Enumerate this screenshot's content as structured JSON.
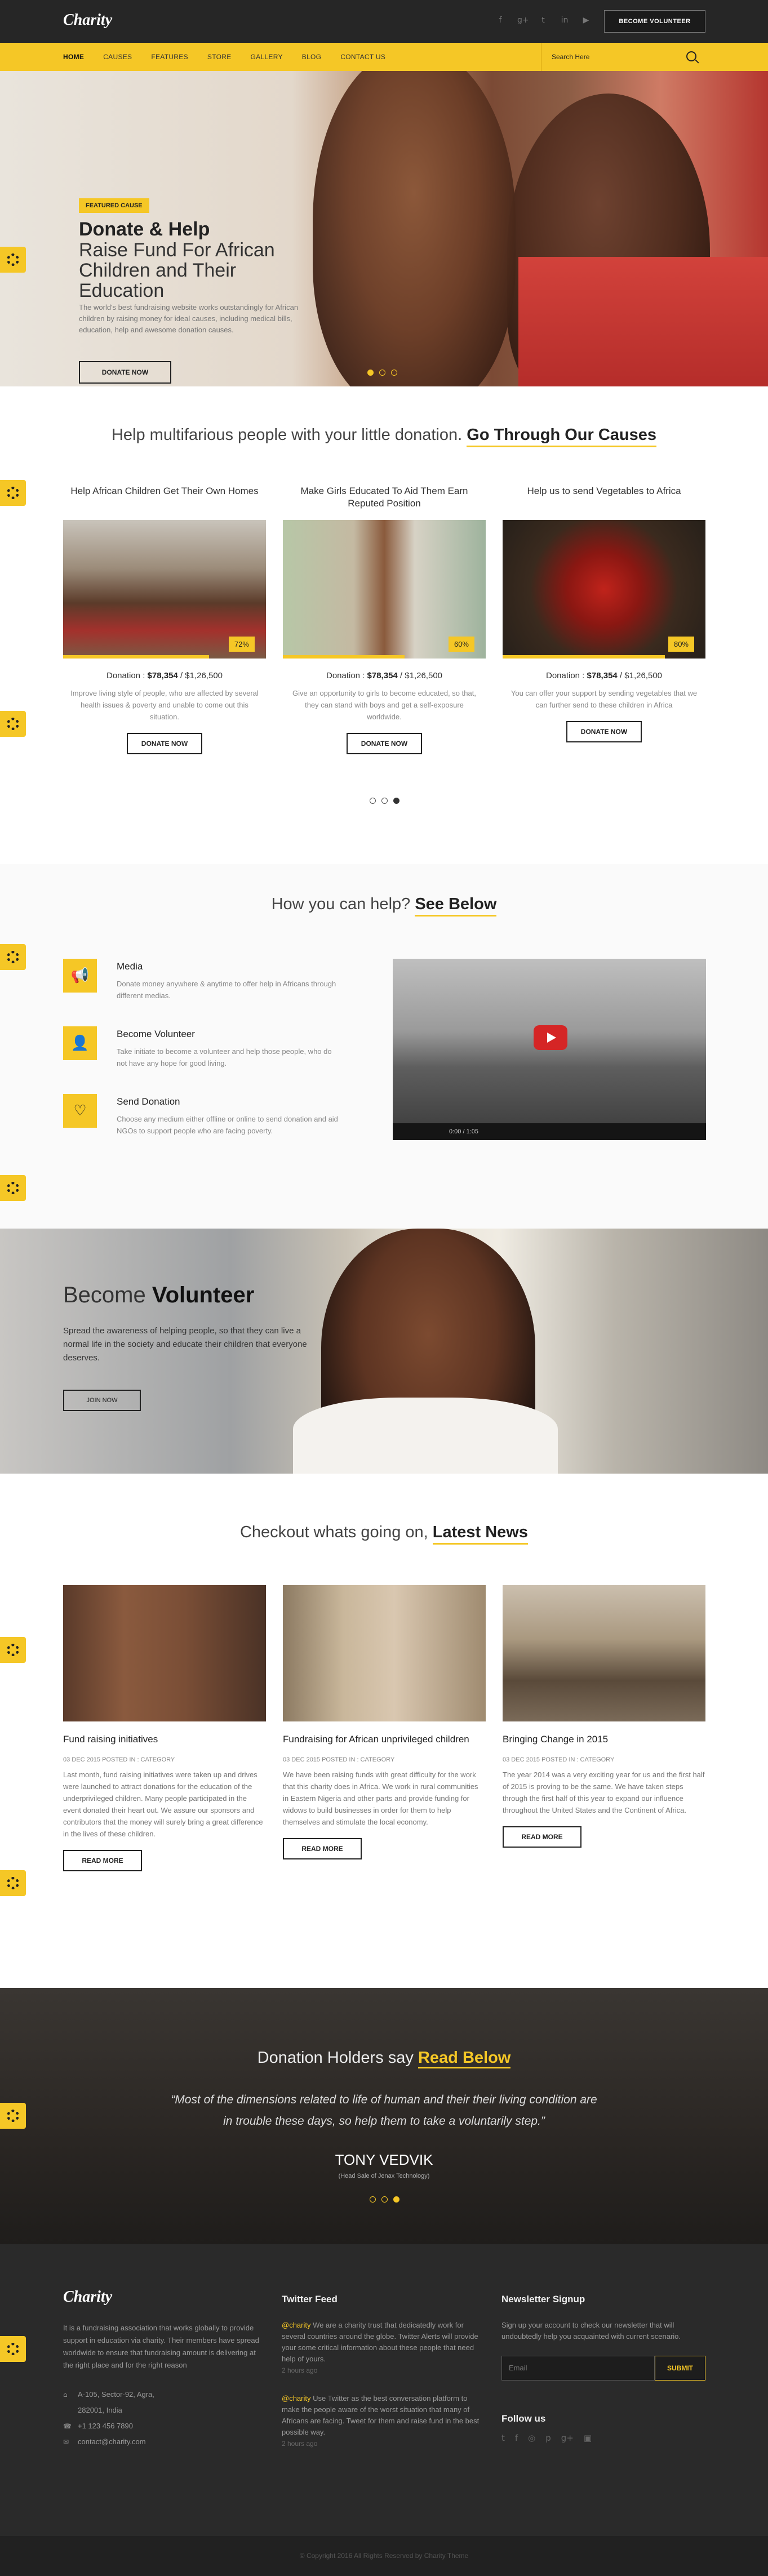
{
  "header": {
    "logo": "Charity",
    "social_icons": [
      "facebook-icon",
      "google-plus-icon",
      "twitter-icon",
      "linkedin-icon",
      "youtube-icon"
    ],
    "social_glyphs": [
      "f",
      "g+",
      "t",
      "in",
      "▶"
    ],
    "volunteer_btn": "BECOME VOLUNTEER"
  },
  "nav": {
    "items": [
      "HOME",
      "CAUSES",
      "FEATURES",
      "STORE",
      "GALLERY",
      "BLOG",
      "CONTACT US"
    ],
    "active": "HOME",
    "search_placeholder": "Search Here"
  },
  "hero": {
    "badge": "FEATURED CAUSE",
    "title": "Donate & Help",
    "subtitle": "Raise Fund For African Children and Their Education",
    "description": "The world's best fundraising website works outstandingly for African children by raising money for ideal causes, including medical bills, education, help and awesome donation causes.",
    "button": "DONATE NOW",
    "slides": 3,
    "active_slide": 1
  },
  "causes": {
    "heading_plain": "Help multifarious people with your little donation. ",
    "heading_bold": "Go Through Our Causes",
    "cards": [
      {
        "title": "Help African Children Get Their Own Homes",
        "percent": "72%",
        "progress": 0.72,
        "donation_label": "Donation : ",
        "raised": "$78,354",
        "goal": " / $1,26,500",
        "desc": "Improve living style of people, who are affected by several health issues & poverty and unable to come out this situation.",
        "button": "DONATE NOW"
      },
      {
        "title": "Make Girls Educated To Aid Them Earn Reputed Position",
        "percent": "60%",
        "progress": 0.6,
        "donation_label": "Donation : ",
        "raised": "$78,354",
        "goal": " / $1,26,500",
        "desc": "Give an opportunity to girls to become educated, so that, they can stand with boys and get a self-exposure worldwide.",
        "button": "DONATE NOW"
      },
      {
        "title": "Help us to send Vegetables to Africa",
        "percent": "80%",
        "progress": 0.8,
        "donation_label": "Donation : ",
        "raised": "$78,354",
        "goal": " / $1,26,500",
        "desc": "You can offer your support by sending vegetables that we can further send to these children in Africa",
        "button": "DONATE NOW"
      }
    ],
    "slides": 3,
    "active_slide": 3
  },
  "help": {
    "heading_plain": "How you can help? ",
    "heading_bold": "See Below",
    "items": [
      {
        "icon": "megaphone-icon",
        "glyph": "📢",
        "title": "Media",
        "text": "Donate money anywhere & anytime to offer help in Africans through different medias."
      },
      {
        "icon": "user-icon",
        "glyph": "👤",
        "title": "Become Volunteer",
        "text": "Take initiate to become a volunteer and help those people, who do not have any hope for good living."
      },
      {
        "icon": "heart-icon",
        "glyph": "♡",
        "title": "Send Donation",
        "text": "Choose any medium either offline or online to send donation and aid NGOs to support people who are facing poverty."
      }
    ],
    "video_time": "0:00 / 1:05"
  },
  "volunteer": {
    "heading_plain": "Become ",
    "heading_bold": "Volunteer",
    "text": "Spread the awareness of helping people, so that they can live a normal life in the society and educate their children that everyone deserves.",
    "button": "JOIN NOW"
  },
  "news": {
    "heading_plain": "Checkout whats going on, ",
    "heading_bold": "Latest News",
    "items": [
      {
        "title": "Fund raising initiatives",
        "meta": "03 DEC 2015   POSTED IN : CATEGORY",
        "text": "Last month, fund raising initiatives were taken up and drives were launched to attract donations for the education of the underprivileged children. Many people participated in the event donated their heart out. We assure our sponsors and contributors that the money will surely bring a great difference in the lives of these children.",
        "button": "READ MORE"
      },
      {
        "title": "Fundraising for African unprivileged children",
        "meta": "03 DEC 2015   POSTED IN : CATEGORY",
        "text": "We have been raising funds with great difficulty for the work that this charity does in Africa. We work in rural communities in Eastern Nigeria and other parts and provide funding for widows to build businesses in order for them to help themselves and stimulate the local economy.",
        "button": "READ MORE"
      },
      {
        "title": "Bringing Change in 2015",
        "meta": "03 DEC 2015   POSTED IN : CATEGORY",
        "text": "The year 2014 was a very exciting year for us and the first half of 2015 is proving to be the same. We have taken steps through the first half of this year to expand our influence throughout the United States and the Continent of Africa.",
        "button": "READ MORE"
      }
    ]
  },
  "testimonials": {
    "heading_plain": "Donation Holders say ",
    "heading_bold": "Read Below",
    "quote": "“Most of the dimensions related to life of human and their their living condition are in trouble these days, so help them to take a voluntarily step.”",
    "name": "TONY VEDVIK",
    "role": "(Head Sale of Jenax Technology)",
    "slides": 3,
    "active_slide": 3
  },
  "footer": {
    "logo": "Charity",
    "about": "It is a fundraising association that works globally to provide support in education via charity. Their members have spread worldwide to ensure that fundraising amount is delivering at the right place and for the right reason",
    "address": "A-105, Sector-92, Agra, 282001, India",
    "phone": "+1 123 456 7890",
    "email": "contact@charity.com",
    "twitter_heading": "Twitter Feed",
    "tweets": [
      {
        "handle": "@charity",
        "text": " We are a charity trust that dedicatedly work for several countries around the globe. Twitter Alerts will provide your some critical information about these people that need help of yours.",
        "ago": "2 hours ago"
      },
      {
        "handle": "@charity",
        "text": " Use Twitter as the best conversation platform to make the people aware of the worst situation that many of Africans are facing. Tweet for them and raise fund in the best possible way.",
        "ago": "2 hours ago"
      }
    ],
    "newsletter_heading": "Newsletter Signup",
    "newsletter_text": "Sign up your account to check our newsletter that will undoubtedly help you acquainted with current scenario.",
    "email_placeholder": "Email",
    "submit": "SUBMIT",
    "follow_heading": "Follow us",
    "follow_icons": [
      "twitter-icon",
      "facebook-icon",
      "dribbble-icon",
      "pinterest-icon",
      "google-plus-icon",
      "instagram-icon"
    ],
    "follow_glyphs": [
      "t",
      "f",
      "◎",
      "p",
      "g+",
      "▣"
    ],
    "copyright": "© Copyright 2016 All Rights Reserved by Charity Theme"
  },
  "colors": {
    "accent": "#f5c726",
    "dark": "#262626",
    "footer": "#2a2a2a"
  }
}
